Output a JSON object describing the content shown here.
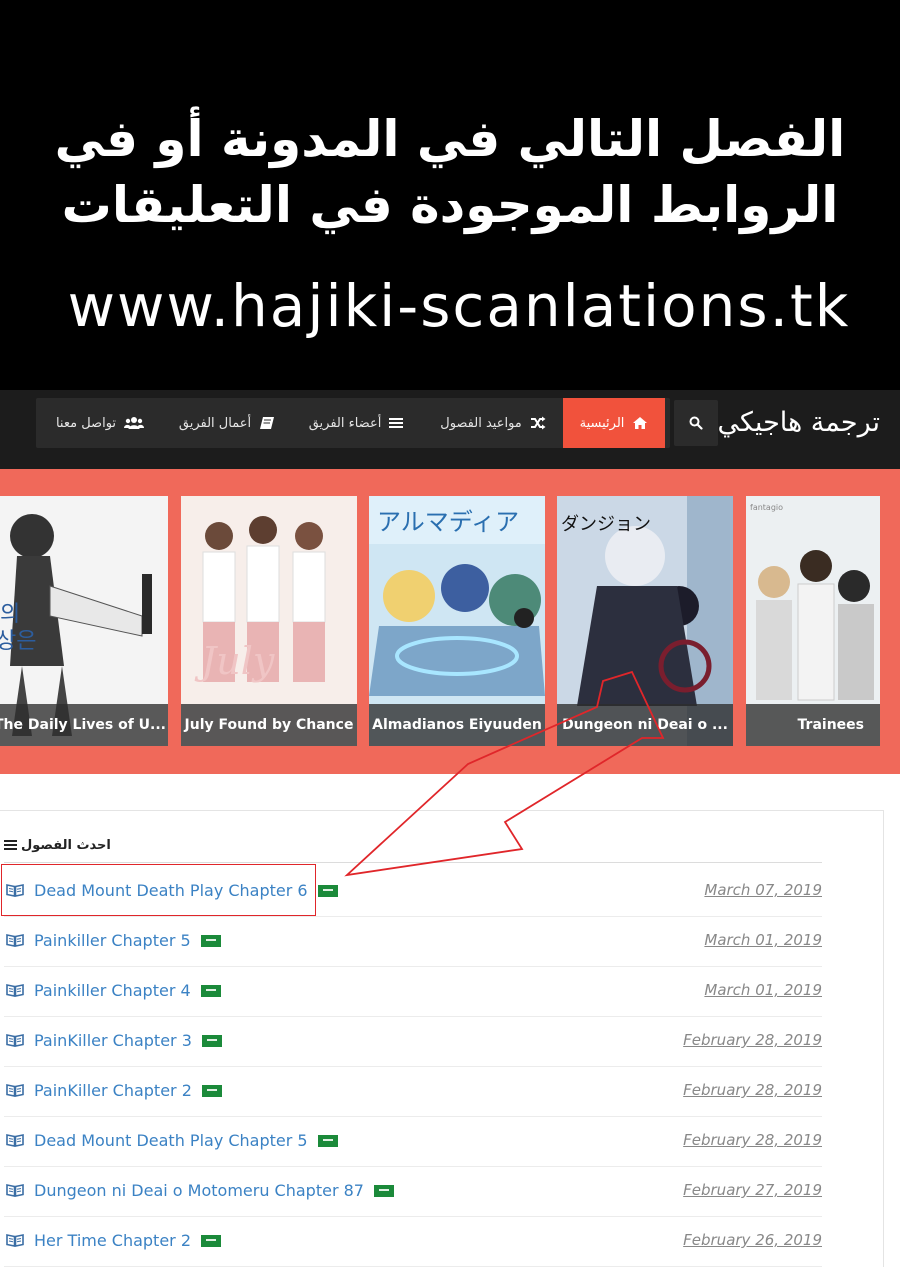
{
  "banner": {
    "line1": "الفصل التالي في المدونة أو في",
    "line2": "الروابط الموجودة في التعليقات",
    "url": "www.hajiki-scanlations.tk"
  },
  "navbar": {
    "site_title": "ترجمة هاجيكي",
    "items": [
      {
        "label": "الرئيسية",
        "icon": "home-icon",
        "active": true
      },
      {
        "label": "مواعيد الفصول",
        "icon": "shuffle-icon",
        "active": false
      },
      {
        "label": "أعضاء الفريق",
        "icon": "list-icon",
        "active": false
      },
      {
        "label": "أعمال الفريق",
        "icon": "book-icon",
        "active": false
      },
      {
        "label": "تواصل معنا",
        "icon": "users-icon",
        "active": false
      }
    ]
  },
  "slider": {
    "cards": [
      {
        "title": "The Daily Lives of U..."
      },
      {
        "title": "July Found by Chance"
      },
      {
        "title": "Almadianos Eiyuuden"
      },
      {
        "title": "Dungeon ni Deai o ..."
      },
      {
        "title": "Trainees"
      }
    ]
  },
  "chapters": {
    "heading": "احدث الفصول",
    "rows": [
      {
        "title": "Dead Mount Death Play Chapter 6",
        "date": "March 07, 2019"
      },
      {
        "title": "Painkiller Chapter 5",
        "date": "March 01, 2019"
      },
      {
        "title": "Painkiller Chapter 4",
        "date": "March 01, 2019"
      },
      {
        "title": "PainKiller Chapter 3",
        "date": "February 28, 2019"
      },
      {
        "title": "PainKiller Chapter 2",
        "date": "February 28, 2019"
      },
      {
        "title": "Dead Mount Death Play Chapter 5",
        "date": "February 28, 2019"
      },
      {
        "title": "Dungeon ni Deai o Motomeru Chapter 87",
        "date": "February 27, 2019"
      },
      {
        "title": "Her Time Chapter 2",
        "date": "February 26, 2019"
      }
    ]
  },
  "colors": {
    "accent": "#f1523c",
    "slider_bg": "#f0695a",
    "link": "#3b82c4",
    "annotation": "#e0262a"
  }
}
